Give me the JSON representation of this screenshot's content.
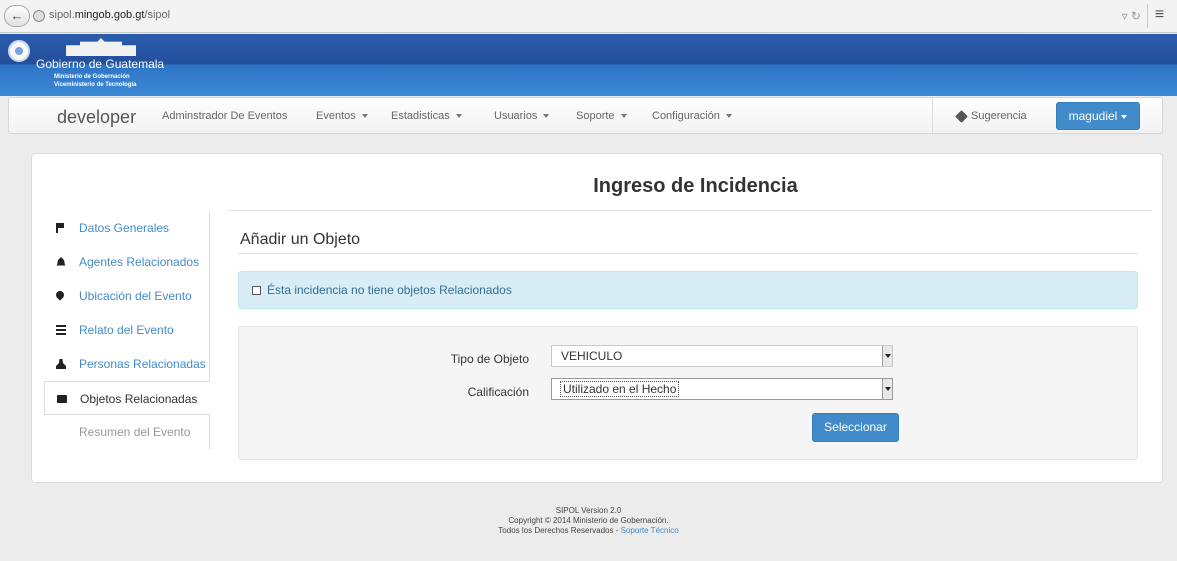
{
  "browser": {
    "url_prefix": "sipol.",
    "url_domain": "mingob.gob.gt",
    "url_path": "/sipol"
  },
  "banner": {
    "org_name": "Gobierno de Guatemala",
    "ministry": "Ministerio de Gobernación",
    "vice_ministry": "Viceministerio de Tecnología"
  },
  "navbar": {
    "brand": "developer",
    "links": [
      {
        "label": "Adminstrador De Eventos",
        "dropdown": false
      },
      {
        "label": "Eventos",
        "dropdown": true
      },
      {
        "label": "Estadisticas",
        "dropdown": true
      },
      {
        "label": "Usuarios",
        "dropdown": true
      },
      {
        "label": "Soporte",
        "dropdown": true
      },
      {
        "label": "Configuración",
        "dropdown": true
      }
    ],
    "suggestion": "Sugerencia",
    "user": "magudiel"
  },
  "page": {
    "title": "Ingreso de Incidencia"
  },
  "sidebar": {
    "items": [
      {
        "label": "Datos Generales",
        "icon": "flag-icon",
        "state": "link"
      },
      {
        "label": "Agentes Relacionados",
        "icon": "bell-icon",
        "state": "link"
      },
      {
        "label": "Ubicación del Evento",
        "icon": "map-marker-icon",
        "state": "link"
      },
      {
        "label": "Relato del Evento",
        "icon": "list-icon",
        "state": "link"
      },
      {
        "label": "Personas Relacionadas",
        "icon": "user-icon",
        "state": "link"
      },
      {
        "label": "Objetos Relacionadas",
        "icon": "briefcase-icon",
        "state": "active"
      },
      {
        "label": "Resumen del Evento",
        "icon": "",
        "state": "disabled"
      }
    ]
  },
  "content": {
    "section_title": "Añadir un Objeto",
    "no_objects_label": "Ésta incidencia no tiene objetos Relacionados",
    "tipo_label": "Tipo de Objeto",
    "tipo_value": "VEHICULO",
    "calificacion_label": "Calificación",
    "calificacion_value": "Utilizado en el Hecho",
    "submit_label": "Seleccionar"
  },
  "footer": {
    "version": "SIPOL Version 2.0",
    "copyright": "Copyright © 2014 Ministerio de Gobernación.",
    "rights": "Todos los Derechos Reservados - ",
    "support_link": "Soporte Técnico"
  }
}
